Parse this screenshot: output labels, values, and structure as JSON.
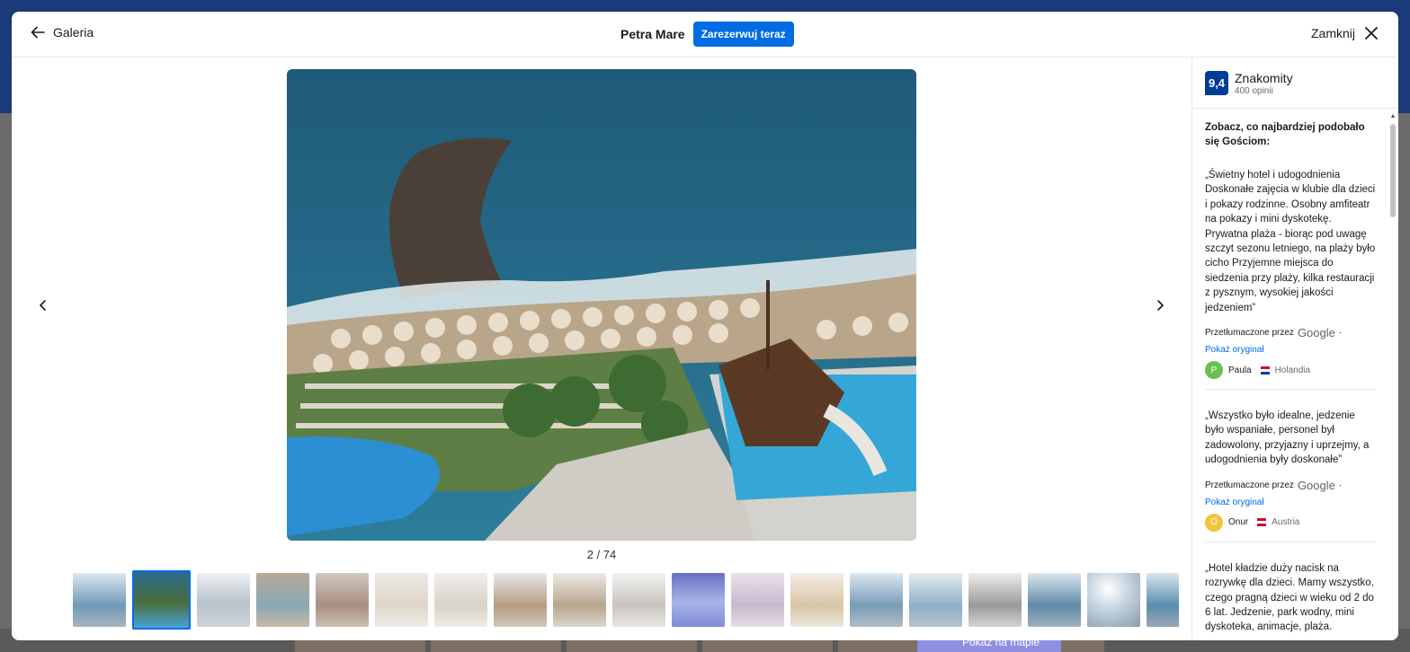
{
  "header": {
    "back_label": "Galeria",
    "hotel_name": "Petra Mare",
    "reserve_label": "Zarezerwuj teraz",
    "close_label": "Zamknij"
  },
  "gallery": {
    "counter": "2 / 74",
    "current_index": 2,
    "total": 74,
    "thumbnail_count_visible": 19,
    "active_thumbnail": 2
  },
  "rating": {
    "score": "9,4",
    "label": "Znakomity",
    "count": "400 opinii"
  },
  "reviews_intro": "Zobacz, co najbardziej podobało się Gościom:",
  "reviews": [
    {
      "quote": "„Świetny hotel i udogodnienia Doskonałe zajęcia w klubie dla dzieci i pokazy rodzinne. Osobny amfiteatr na pokazy i mini dyskotekę. Prywatna plaża - biorąc pod uwagę szczyt sezonu letniego, na plaży było cicho Przyjemne miejsca do siedzenia przy plaży, kilka restauracji z pysznym, wysokiej jakości jedzeniem”",
      "translated_by": "Przetłumaczone przez",
      "translator": "Google",
      "show_original": "Pokaż oryginał",
      "author_initial": "P",
      "author": "Paula",
      "country": "Holandia",
      "avatar_color": "#6cbf4f"
    },
    {
      "quote": "„Wszystko było idealne, jedzenie było wspaniałe, personel był zadowolony, przyjazny i uprzejmy, a udogodnienia były doskonałe”",
      "translated_by": "Przetłumaczone przez",
      "translator": "Google",
      "show_original": "Pokaż oryginał",
      "author_initial": "O",
      "author": "Onur",
      "country": "Austria",
      "avatar_color": "#f5c33b"
    },
    {
      "quote": "„Hotel kładzie duży nacisk na rozrywkę dla dzieci. Mamy wszystko, czego pragną dzieci w wieku od 2 do 6 lat. Jedzenie, park wodny, mini dyskoteka, animacje, plaża."
    }
  ],
  "background": {
    "map_button": "Pokaż na mapie"
  },
  "colors": {
    "accent": "#006ce4",
    "score_bg": "#003b95",
    "header_bg": "#1a3a78"
  }
}
